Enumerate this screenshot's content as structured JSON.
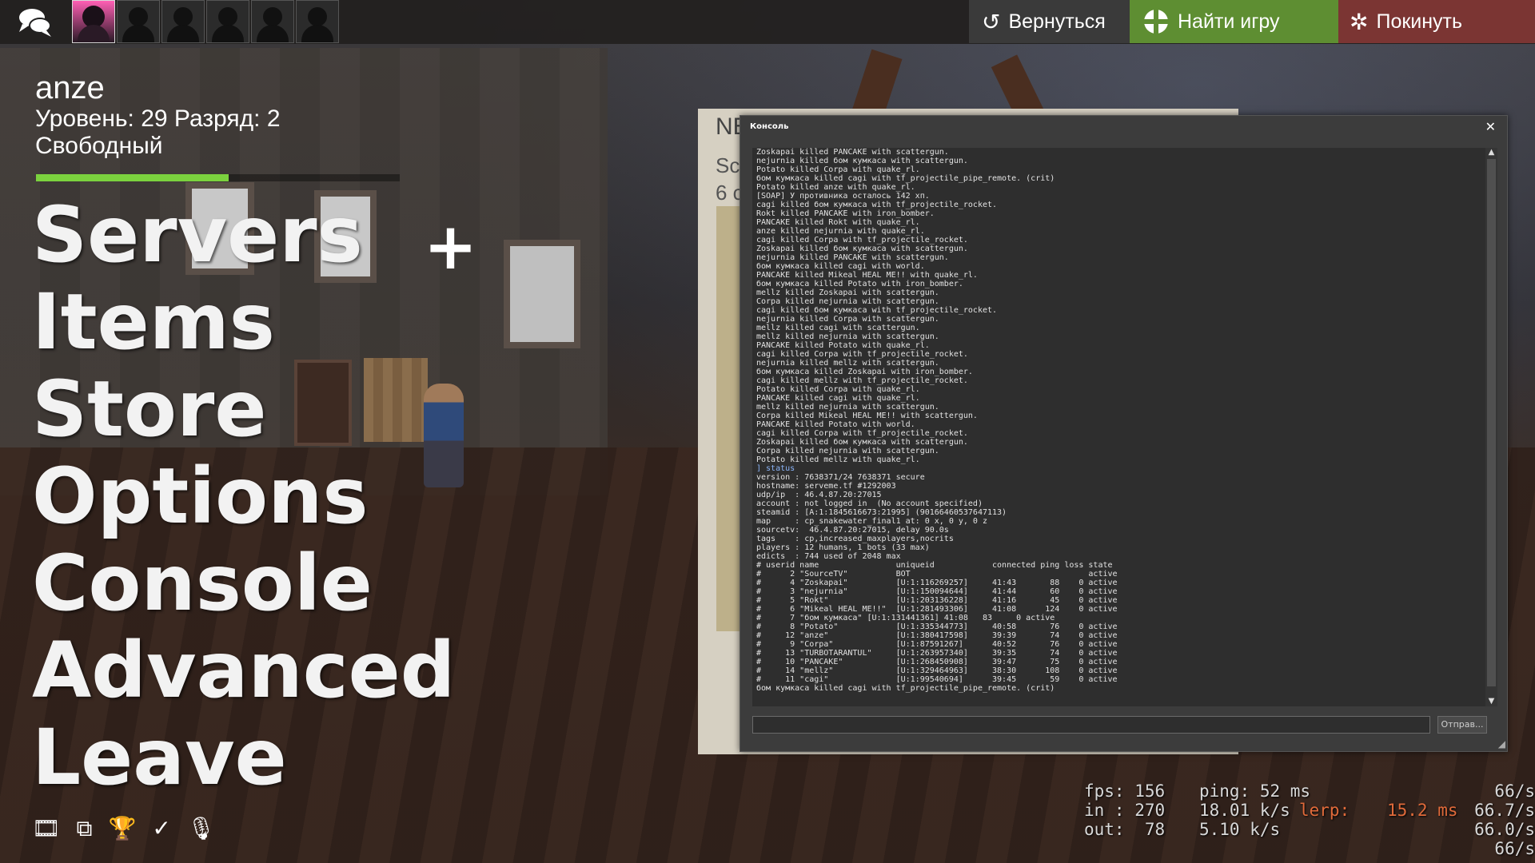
{
  "topbar": {
    "return_label": "Вернуться",
    "find_game_label": "Найти игру",
    "quit_label": "Покинуть",
    "avatar_count": 6
  },
  "player": {
    "name": "anze",
    "level_line": "Уровень: 29 Разряд: 2",
    "status": "Свободный",
    "xp_progress": 0.53
  },
  "menu": {
    "items": [
      "Servers",
      "Items",
      "Store",
      "Options",
      "Console",
      "Advanced",
      "Leave"
    ]
  },
  "news": {
    "title": "NE",
    "line1": "Sc",
    "line2": "6 c"
  },
  "console": {
    "title": "Консоль",
    "submit_label": "Отправ...",
    "lines": [
      {
        "t": "Zoskapai killed PANCAKE with scattergun.",
        "cmd": false
      },
      {
        "t": "nejurnia killed бом кумкаса with scattergun.",
        "cmd": false
      },
      {
        "t": "Potato killed Corpa with quake_rl.",
        "cmd": false
      },
      {
        "t": "бом кумкаса killed cagi with tf_projectile_pipe_remote. (crit)",
        "cmd": false
      },
      {
        "t": "Potato killed anze with quake_rl.",
        "cmd": false
      },
      {
        "t": "[SOAP] У противника осталось 142 хп.",
        "cmd": false
      },
      {
        "t": "cagi killed бом кумкаса with tf_projectile_rocket.",
        "cmd": false
      },
      {
        "t": "Rokt killed PANCAKE with iron_bomber.",
        "cmd": false
      },
      {
        "t": "PANCAKE killed Rokt with quake_rl.",
        "cmd": false
      },
      {
        "t": "anze killed nejurnia with quake_rl.",
        "cmd": false
      },
      {
        "t": "cagi killed Corpa with tf_projectile_rocket.",
        "cmd": false
      },
      {
        "t": "Zoskapai killed бом кумкаса with scattergun.",
        "cmd": false
      },
      {
        "t": "nejurnia killed PANCAKE with scattergun.",
        "cmd": false
      },
      {
        "t": "бом кумкаса killed cagi with world.",
        "cmd": false
      },
      {
        "t": "PANCAKE killed Mikeal HEAL ME!! with quake_rl.",
        "cmd": false
      },
      {
        "t": "бом кумкаса killed Potato with iron_bomber.",
        "cmd": false
      },
      {
        "t": "mellz killed Zoskapai with scattergun.",
        "cmd": false
      },
      {
        "t": "Corpa killed nejurnia with scattergun.",
        "cmd": false
      },
      {
        "t": "cagi killed бом кумкаса with tf_projectile_rocket.",
        "cmd": false
      },
      {
        "t": "nejurnia killed Corpa with scattergun.",
        "cmd": false
      },
      {
        "t": "mellz killed cagi with scattergun.",
        "cmd": false
      },
      {
        "t": "mellz killed nejurnia with scattergun.",
        "cmd": false
      },
      {
        "t": "PANCAKE killed Potato with quake_rl.",
        "cmd": false
      },
      {
        "t": "cagi killed Corpa with tf_projectile_rocket.",
        "cmd": false
      },
      {
        "t": "nejurnia killed mellz with scattergun.",
        "cmd": false
      },
      {
        "t": "бом кумкаса killed Zoskapai with iron_bomber.",
        "cmd": false
      },
      {
        "t": "cagi killed mellz with tf_projectile_rocket.",
        "cmd": false
      },
      {
        "t": "Potato killed Corpa with quake_rl.",
        "cmd": false
      },
      {
        "t": "PANCAKE killed cagi with quake_rl.",
        "cmd": false
      },
      {
        "t": "mellz killed nejurnia with scattergun.",
        "cmd": false
      },
      {
        "t": "Corpa killed Mikeal HEAL ME!! with scattergun.",
        "cmd": false
      },
      {
        "t": "PANCAKE killed Potato with world.",
        "cmd": false
      },
      {
        "t": "cagi killed Corpa with tf_projectile_rocket.",
        "cmd": false
      },
      {
        "t": "Zoskapai killed бом кумкаса with scattergun.",
        "cmd": false
      },
      {
        "t": "Corpa killed nejurnia with scattergun.",
        "cmd": false
      },
      {
        "t": "Potato killed mellz with quake_rl.",
        "cmd": false
      },
      {
        "t": "] status",
        "cmd": true
      },
      {
        "t": "version : 7638371/24 7638371 secure",
        "cmd": false
      },
      {
        "t": "hostname: serveme.tf #1292003",
        "cmd": false
      },
      {
        "t": "udp/ip  : 46.4.87.20:27015",
        "cmd": false
      },
      {
        "t": "account : not logged in  (No account specified)",
        "cmd": false
      },
      {
        "t": "steamid : [A:1:1845616673:21995] (90166460537647113)",
        "cmd": false
      },
      {
        "t": "map     : cp_snakewater_final1 at: 0 x, 0 y, 0 z",
        "cmd": false
      },
      {
        "t": "sourcetv:  46.4.87.20:27015, delay 90.0s",
        "cmd": false
      },
      {
        "t": "tags    : cp,increased_maxplayers,nocrits",
        "cmd": false
      },
      {
        "t": "players : 12 humans, 1 bots (33 max)",
        "cmd": false
      },
      {
        "t": "edicts  : 744 used of 2048 max",
        "cmd": false
      },
      {
        "t": "# userid name                uniqueid            connected ping loss state",
        "cmd": false
      },
      {
        "t": "#      2 \"SourceTV\"          BOT                                     active",
        "cmd": false
      },
      {
        "t": "#      4 \"Zoskapai\"          [U:1:116269257]     41:43       88    0 active",
        "cmd": false
      },
      {
        "t": "#      3 \"nejurnia\"          [U:1:150094644]     41:44       60    0 active",
        "cmd": false
      },
      {
        "t": "#      5 \"Rokt\"              [U:1:203136228]     41:16       45    0 active",
        "cmd": false
      },
      {
        "t": "#      6 \"Mikeal HEAL ME!!\"  [U:1:281493306]     41:08      124    0 active",
        "cmd": false
      },
      {
        "t": "#      7 \"бом кумкаса\" [U:1:131441361] 41:08   83     0 active",
        "cmd": false
      },
      {
        "t": "#      8 \"Potato\"            [U:1:335344773]     40:58       76    0 active",
        "cmd": false
      },
      {
        "t": "#     12 \"anze\"              [U:1:380417598]     39:39       74    0 active",
        "cmd": false
      },
      {
        "t": "#      9 \"Corpa\"             [U:1:87591267]      40:52       76    0 active",
        "cmd": false
      },
      {
        "t": "#     13 \"TURBOTARANTUL\"     [U:1:263957340]     39:35       74    0 active",
        "cmd": false
      },
      {
        "t": "#     10 \"PANCAKE\"           [U:1:268450908]     39:47       75    0 active",
        "cmd": false
      },
      {
        "t": "#     14 \"mellz\"             [U:1:329464963]     38:30      108    0 active",
        "cmd": false
      },
      {
        "t": "#     11 \"cagi\"              [U:1:99540694]      39:45       59    0 active",
        "cmd": false
      },
      {
        "t": "бом кумкаса killed cagi with tf_projectile_pipe_remote. (crit)",
        "cmd": false
      }
    ]
  },
  "netgraph": {
    "fps": "fps: 156",
    "ping": "ping: 52 ms",
    "in_label": "in : 270",
    "in_rate": "18.01 k/s",
    "lerp_label": "lerp:",
    "lerp_value": "15.2 ms",
    "out_label": "out:  78",
    "out_rate": "5.10 k/s",
    "rate1": "66/s",
    "rate2": "66.7/s",
    "rate3": "66.0/s",
    "rate4": "66/s"
  },
  "colors": {
    "find_game_green": "#5e8e32",
    "quit_red": "#7b3533",
    "xp_green": "#7bd23e",
    "lerp_orange": "#e06a3a"
  }
}
